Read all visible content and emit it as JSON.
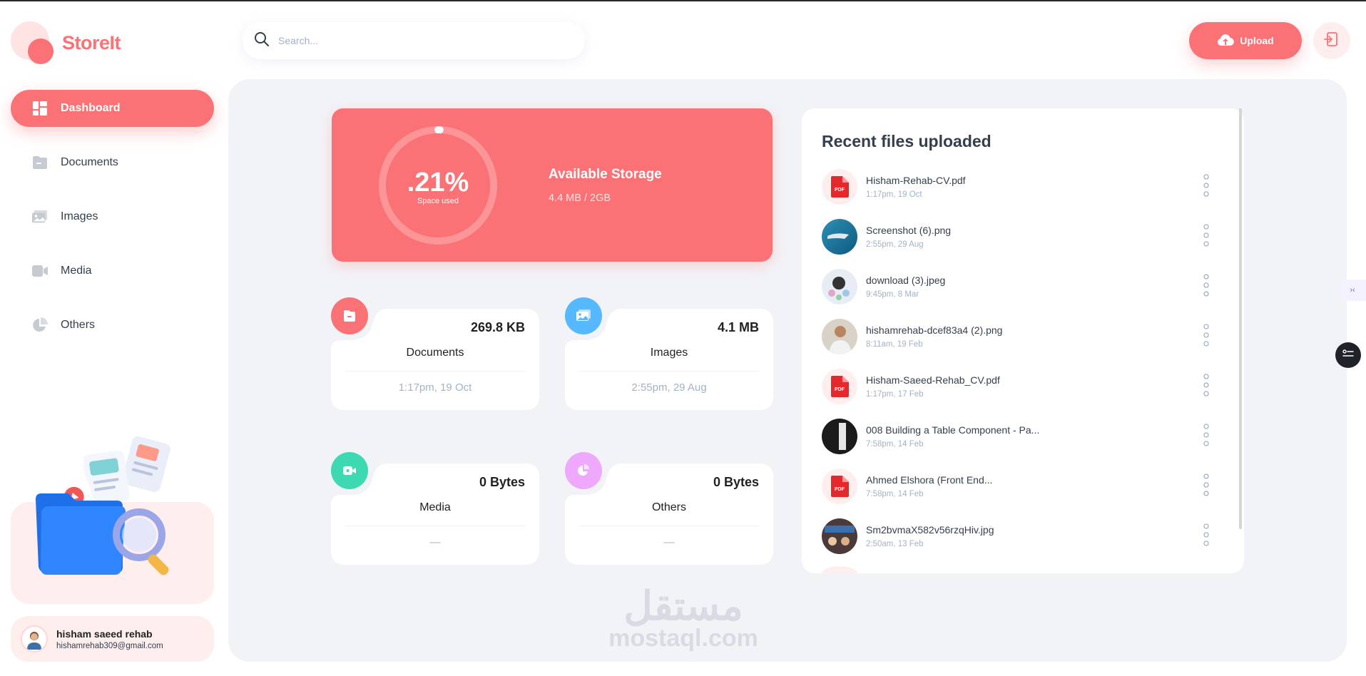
{
  "app": {
    "name": "StoreIt"
  },
  "sidebar": {
    "items": [
      {
        "label": "Dashboard",
        "icon": "dashboard-icon",
        "active": true
      },
      {
        "label": "Documents",
        "icon": "documents-icon",
        "active": false
      },
      {
        "label": "Images",
        "icon": "images-icon",
        "active": false
      },
      {
        "label": "Media",
        "icon": "media-icon",
        "active": false
      },
      {
        "label": "Others",
        "icon": "others-icon",
        "active": false
      }
    ]
  },
  "user": {
    "name": "hisham saeed rehab",
    "email": "hishamrehab309@gmail.com"
  },
  "search": {
    "placeholder": "Search..."
  },
  "header": {
    "upload_label": "Upload"
  },
  "storage": {
    "percent_label": ".21%",
    "percent_value": 0.21,
    "sub_label": "Space used",
    "title": "Available Storage",
    "value": "4.4 MB / 2GB"
  },
  "cards": [
    {
      "name": "Documents",
      "size": "269.8 KB",
      "date": "1:17pm, 19 Oct",
      "color": "#FA7275",
      "icon": "folder-doc-icon"
    },
    {
      "name": "Images",
      "size": "4.1 MB",
      "date": "2:55pm, 29 Aug",
      "color": "#56B8FF",
      "icon": "image-icon"
    },
    {
      "name": "Media",
      "size": "0 Bytes",
      "date": "—",
      "color": "#3DD9B3",
      "icon": "video-icon"
    },
    {
      "name": "Others",
      "size": "0 Bytes",
      "date": "—",
      "color": "#EEA8FD",
      "icon": "pie-icon"
    }
  ],
  "recent": {
    "title": "Recent files uploaded",
    "files": [
      {
        "name": "Hisham-Rehab-CV.pdf",
        "date": "1:17pm, 19 Oct",
        "thumb": "pdf-icon"
      },
      {
        "name": "Screenshot (6).png",
        "date": "2:55pm, 29 Aug",
        "thumb": "image-thumbnail"
      },
      {
        "name": "download (3).jpeg",
        "date": "9:45pm, 8 Mar",
        "thumb": "image-thumbnail"
      },
      {
        "name": "hishamrehab-dcef83a4 (2).png",
        "date": "8:11am, 19 Feb",
        "thumb": "image-thumbnail"
      },
      {
        "name": "Hisham-Saeed-Rehab_CV.pdf",
        "date": "1:17pm, 17 Feb",
        "thumb": "pdf-icon"
      },
      {
        "name": "008 Building a Table Component - Pa...",
        "date": "7:58pm, 14 Feb",
        "thumb": "video-thumbnail"
      },
      {
        "name": "Ahmed Elshora (Front End...",
        "date": "7:58pm, 14 Feb",
        "thumb": "pdf-icon"
      },
      {
        "name": "Sm2bvmaX582v56rzqHiv.jpg",
        "date": "2:50am, 13 Feb",
        "thumb": "image-thumbnail"
      }
    ]
  },
  "watermark": {
    "arabic": "مستقل",
    "latin": "mostaql.com"
  },
  "colors": {
    "brand": "#FA7275",
    "brand_light": "#FFEEEE",
    "main_bg": "#F2F3F7",
    "text": "#333F4E",
    "muted": "#A3B2C7"
  }
}
